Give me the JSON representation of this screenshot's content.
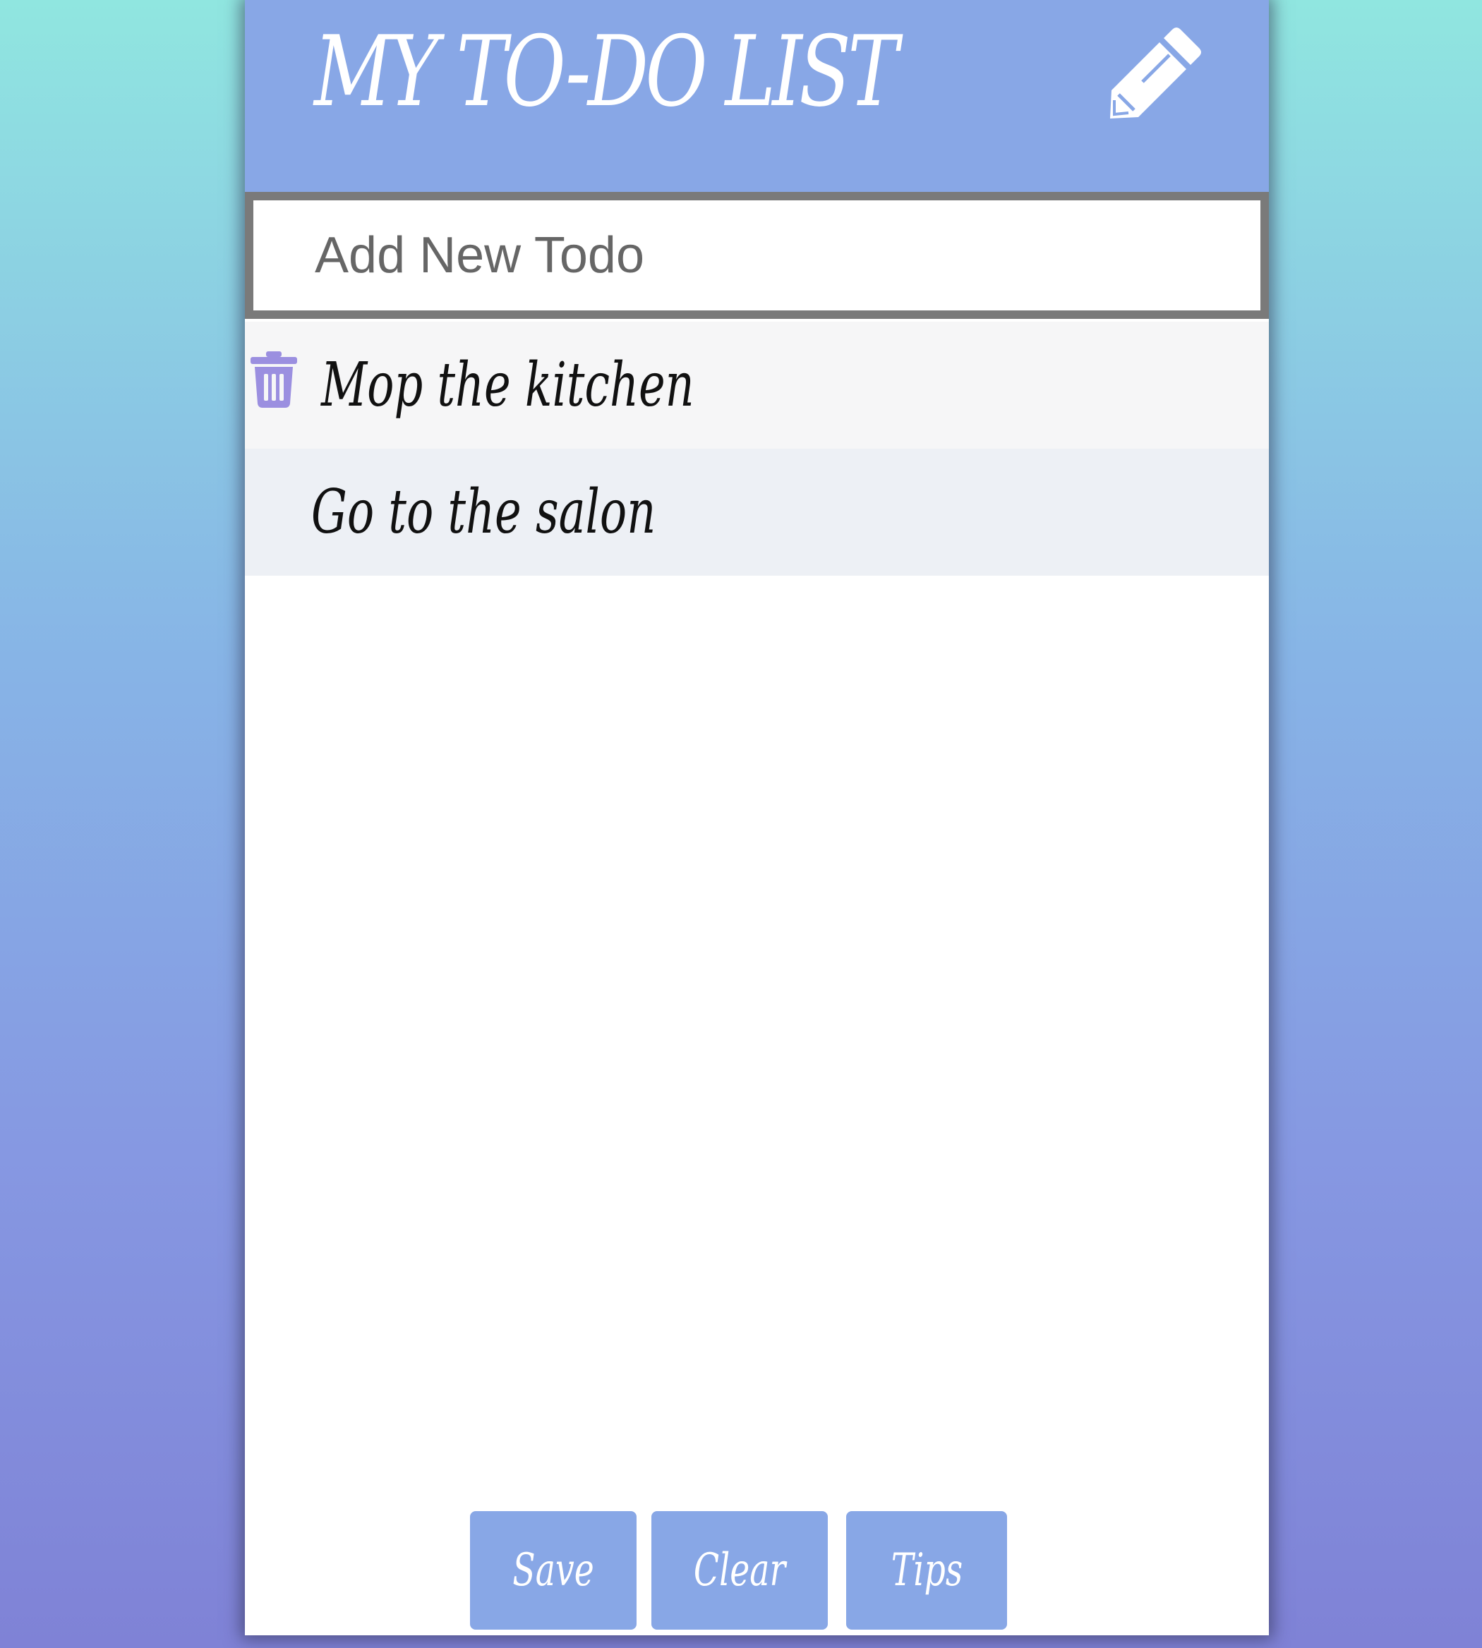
{
  "app": {
    "title": "MY TO-DO LIST",
    "header_icon": "pencil-icon"
  },
  "new_todo": {
    "placeholder": "Add New Todo",
    "value": ""
  },
  "todos": [
    {
      "text": "Mop the kitchen",
      "delete_icon": "trash-icon"
    },
    {
      "text": "Go to the salon"
    }
  ],
  "buttons": {
    "save": "Save",
    "clear": "Clear",
    "tips": "Tips"
  },
  "colors": {
    "accent": "#88a7e6",
    "trash_icon": "#9b8fe0",
    "input_border": "#7a7a7a"
  }
}
